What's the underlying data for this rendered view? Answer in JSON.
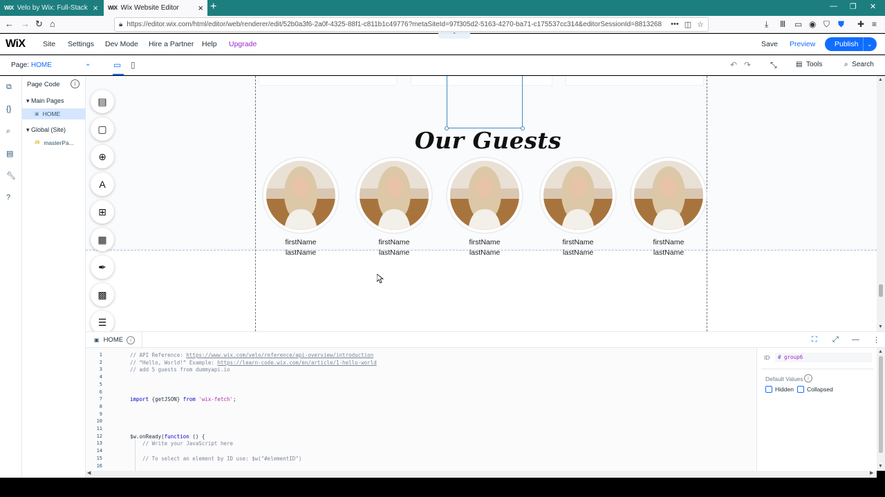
{
  "browser": {
    "tabs": [
      {
        "title": "Velo by Wix: Full-Stack Web De",
        "favicon": "WiX",
        "active": false
      },
      {
        "title": "Wix Website Editor",
        "favicon": "WiX",
        "active": true
      }
    ],
    "url": "https://editor.wix.com/html/editor/web/renderer/edit/52b0a3f6-2a0f-4325-88f1-c811b1c49776?metaSiteId=97f305d2-5163-4270-ba71-c175537cc314&editorSessionId=8813268"
  },
  "topbar": {
    "logo": "WiX",
    "menu": [
      "Site",
      "Settings",
      "Dev Mode",
      "Hire a Partner",
      "Help",
      "Upgrade"
    ],
    "save": "Save",
    "preview": "Preview",
    "publish": "Publish"
  },
  "pagebar": {
    "page_label": "Page:",
    "page_name": "HOME",
    "tools": "Tools",
    "search": "Search"
  },
  "code_panel": {
    "title": "Page Code",
    "groups": [
      {
        "label": "Main Pages",
        "items": [
          "HOME"
        ]
      },
      {
        "label": "Global (Site)",
        "items": [
          "masterPa..."
        ]
      }
    ]
  },
  "canvas": {
    "heading": "Our Guests",
    "guests": [
      {
        "first": "firstName",
        "last": "lastName"
      },
      {
        "first": "firstName",
        "last": "lastName"
      },
      {
        "first": "firstName",
        "last": "lastName"
      },
      {
        "first": "firstName",
        "last": "lastName"
      },
      {
        "first": "firstName",
        "last": "lastName"
      }
    ]
  },
  "editor": {
    "tab": "HOME",
    "lines": [
      {
        "n": "1",
        "parts": [
          [
            "c-comment",
            "// API Reference: "
          ],
          [
            "c-link",
            "https://www.wix.com/velo/reference/api-overview/introduction"
          ]
        ]
      },
      {
        "n": "2",
        "parts": [
          [
            "c-comment",
            "// “Hello, World!” Example: "
          ],
          [
            "c-link",
            "https://learn-code.wix.com/en/article/1-hello-world"
          ]
        ]
      },
      {
        "n": "3",
        "parts": [
          [
            "c-comment",
            "// add 5 guests from dummyapi.io"
          ]
        ]
      },
      {
        "n": "4",
        "parts": []
      },
      {
        "n": "5",
        "parts": []
      },
      {
        "n": "6",
        "parts": []
      },
      {
        "n": "7",
        "parts": [
          [
            "c-kw",
            "import"
          ],
          [
            "",
            " {getJSON} "
          ],
          [
            "c-kw",
            "from"
          ],
          [
            "",
            " "
          ],
          [
            "c-str",
            "'wix-fetch'"
          ],
          [
            "",
            ";"
          ]
        ]
      },
      {
        "n": "8",
        "parts": []
      },
      {
        "n": "9",
        "parts": []
      },
      {
        "n": "10",
        "parts": []
      },
      {
        "n": "11",
        "parts": []
      },
      {
        "n": "12",
        "parts": [
          [
            "",
            "$w.onReady("
          ],
          [
            "c-kw",
            "function"
          ],
          [
            "",
            " () {"
          ]
        ]
      },
      {
        "n": "13",
        "parts": [
          [
            "c-comment",
            "    // Write your JavaScript here"
          ]
        ]
      },
      {
        "n": "14",
        "parts": []
      },
      {
        "n": "15",
        "parts": [
          [
            "c-comment",
            "    // To select an element by ID use: $w(\"#elementID\")"
          ]
        ]
      },
      {
        "n": "16",
        "parts": []
      }
    ]
  },
  "properties": {
    "id_label": "ID",
    "id_value": "# group6",
    "default_values": "Default Values",
    "hidden": "Hidden",
    "collapsed": "Collapsed"
  },
  "colors": {
    "accent": "#116dff",
    "upgrade": "#9a27d5",
    "tabbar": "#1d7e7f"
  }
}
